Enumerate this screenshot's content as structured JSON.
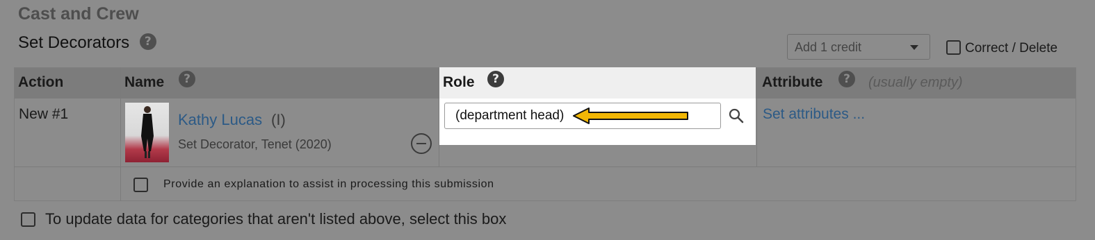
{
  "section": {
    "title": "Cast and Crew"
  },
  "subsection": {
    "title": "Set Decorators",
    "help": "?"
  },
  "controls": {
    "add_credit": "Add 1 credit",
    "correct_delete_label": "Correct / Delete"
  },
  "table": {
    "headers": {
      "action": "Action",
      "name": "Name",
      "role": "Role",
      "attribute": "Attribute",
      "attribute_hint": "(usually empty)",
      "help": "?"
    },
    "row": {
      "action": "New #1",
      "name": "Kathy Lucas",
      "name_suffix": "(I)",
      "subtitle": "Set Decorator, Tenet (2020)",
      "role_value": "(department head)",
      "attribute_link": "Set attributes ..."
    },
    "explanation_label": "Provide an explanation to assist in processing this submission"
  },
  "bottom": {
    "label": "To update data for categories that aren't listed above, select this box"
  },
  "colors": {
    "backdrop": "#8c8c8c",
    "link": "#2c5a86",
    "arrow_fill": "#f2b705",
    "highlight": "#ffffff"
  },
  "icons": [
    "help-icon",
    "chevron-down-icon",
    "search-icon",
    "remove-circle-icon",
    "arrow-left-icon"
  ]
}
